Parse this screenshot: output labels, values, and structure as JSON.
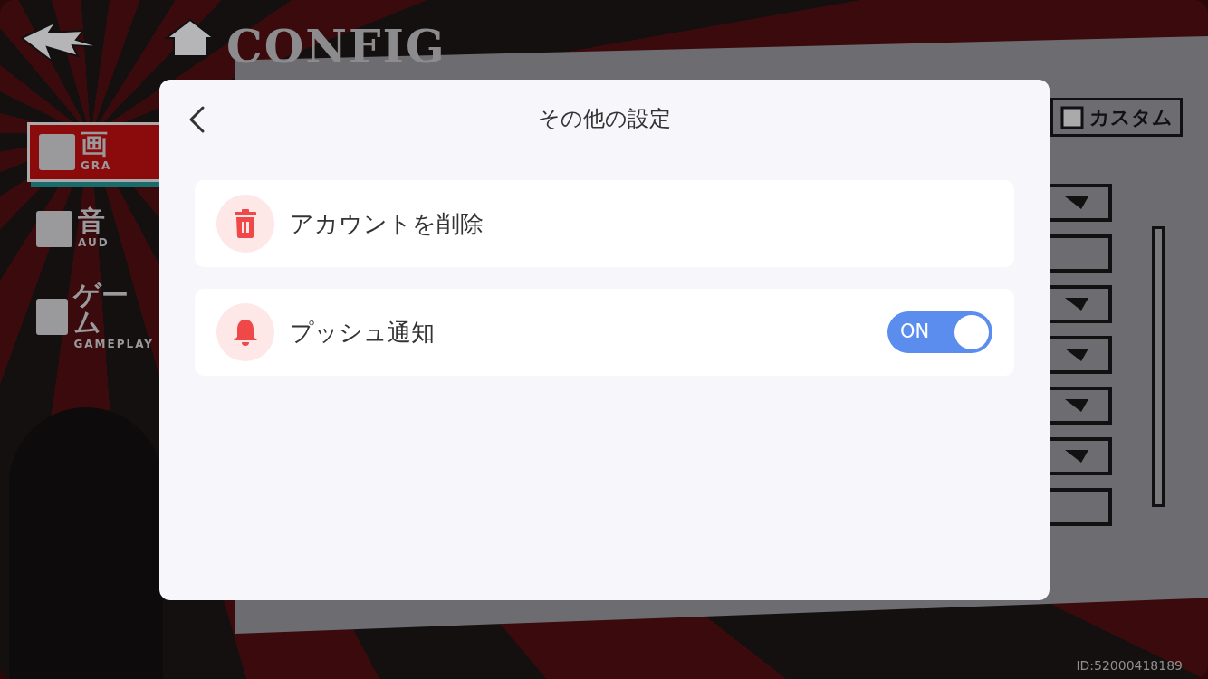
{
  "background": {
    "title": "CONFIG",
    "menu": [
      {
        "label": "画",
        "sublabel": "GRA",
        "selected": true
      },
      {
        "label": "音",
        "sublabel": "AUD",
        "selected": false
      },
      {
        "label": "ゲーム",
        "sublabel": "GAMEPLAY",
        "selected": false
      }
    ],
    "custom_label": "カスタム",
    "dropdowns": [
      {
        "kind": "select"
      },
      {
        "kind": "blank"
      },
      {
        "kind": "select"
      },
      {
        "kind": "select"
      },
      {
        "kind": "select"
      },
      {
        "kind": "select"
      },
      {
        "kind": "blank"
      }
    ],
    "id_text": "ID:52000418189"
  },
  "dialog": {
    "title": "その他の設定",
    "items": [
      {
        "kind": "action",
        "label": "アカウントを削除"
      },
      {
        "kind": "toggle",
        "label": "プッシュ通知",
        "on": true,
        "toggle_text": "ON"
      }
    ]
  }
}
